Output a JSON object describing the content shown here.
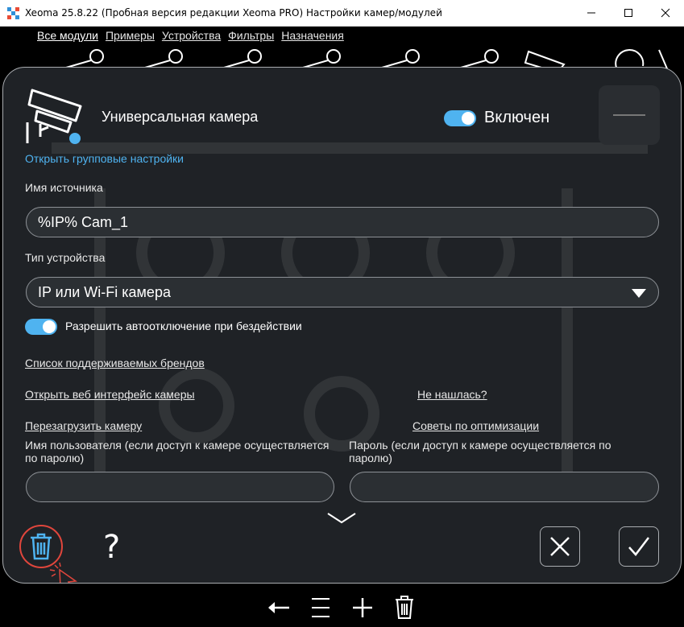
{
  "window": {
    "title": "Xeoma 25.8.22 (Пробная версия редакции Xeoma PRO) Настройки камер/модулей",
    "minimize": "minimize",
    "maximize": "maximize",
    "close": "close"
  },
  "bg_menu": [
    {
      "label": "Все модули",
      "active": true
    },
    {
      "label": "Примеры",
      "active": false
    },
    {
      "label": "Устройства",
      "active": false
    },
    {
      "label": "Фильтры",
      "active": false
    },
    {
      "label": "Назначения",
      "active": false
    }
  ],
  "dialog": {
    "module_title": "Универсальная камера",
    "enabled_label": "Включен",
    "enabled": true,
    "group_settings_link": "Открыть групповые настройки",
    "source_name_label": "Имя источника",
    "source_name_value": "%IP% Cam_1",
    "device_type_label": "Тип устройства",
    "device_type_value": "IP или Wi-Fi камера",
    "auto_disable_label": "Разрешить автоотключение при бездействии",
    "auto_disable": true,
    "brands_link": "Список поддерживаемых брендов",
    "web_interface_link": "Открыть веб интерфейс камеры",
    "not_found_link": "Не нашлась?",
    "restart_link": "Перезагрузить камеру",
    "optimization_link": "Советы по оптимизации",
    "username_label": "Имя пользователя (если доступ к камере осуществляется по паролю)",
    "username_value": "",
    "password_label": "Пароль (если доступ к камере осуществляется по паролю)",
    "password_value": "",
    "help_label": "?",
    "accent_color": "#4fb3f0",
    "delete_highlight_color": "#e0463c"
  },
  "bottom_toolbar": [
    "back-arrow-icon",
    "menu-icon",
    "add-icon",
    "trash-icon"
  ]
}
